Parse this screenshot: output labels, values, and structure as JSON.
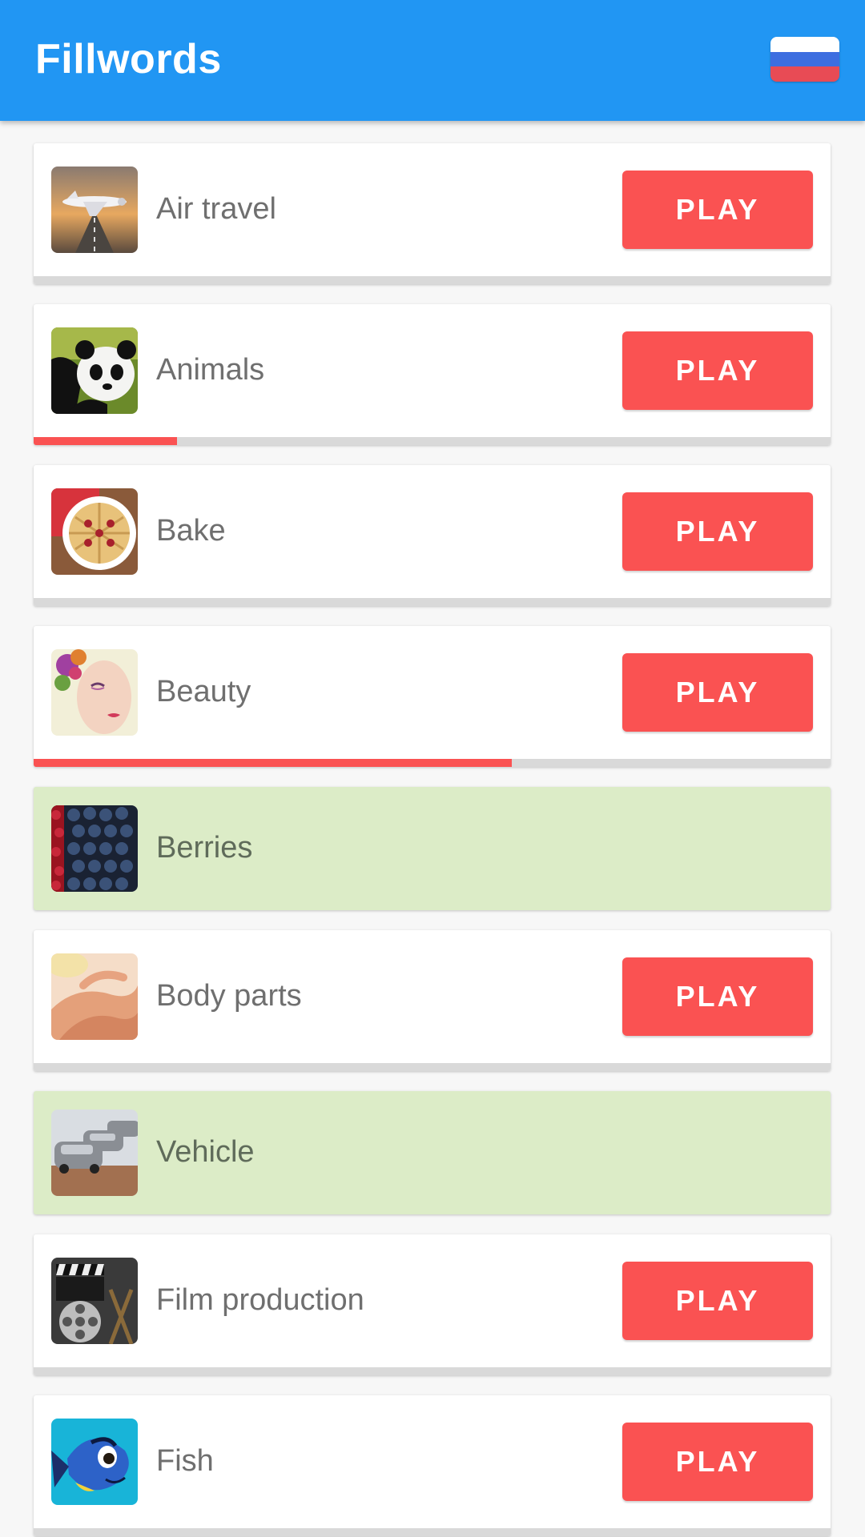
{
  "app": {
    "title": "Fillwords",
    "language_flag": "russia-flag-icon",
    "flag_colors": [
      "#ffffff",
      "#3d6ee0",
      "#e84b55"
    ]
  },
  "colors": {
    "appbar": "#2196f3",
    "play_button": "#fa5252",
    "completed_card": "#dcecc7",
    "progress_fill": "#fa5252",
    "progress_track": "#d9d9d9"
  },
  "categories": [
    {
      "name": "Air travel",
      "image": "airplane-image",
      "status": "in_progress",
      "progress": 0,
      "button_label": "PLAY"
    },
    {
      "name": "Animals",
      "image": "panda-image",
      "status": "in_progress",
      "progress": 0.18,
      "button_label": "PLAY"
    },
    {
      "name": "Bake",
      "image": "pie-image",
      "status": "in_progress",
      "progress": 0,
      "button_label": "PLAY"
    },
    {
      "name": "Beauty",
      "image": "face-image",
      "status": "in_progress",
      "progress": 0.6,
      "button_label": "PLAY"
    },
    {
      "name": "Berries",
      "image": "blueberries-image",
      "status": "completed"
    },
    {
      "name": "Body parts",
      "image": "hands-image",
      "status": "in_progress",
      "progress": 0,
      "button_label": "PLAY"
    },
    {
      "name": "Vehicle",
      "image": "cars-image",
      "status": "completed"
    },
    {
      "name": "Film production",
      "image": "film-reel-image",
      "status": "in_progress",
      "progress": 0,
      "button_label": "PLAY"
    },
    {
      "name": "Fish",
      "image": "blue-fish-image",
      "status": "in_progress",
      "progress": 0,
      "button_label": "PLAY"
    }
  ]
}
